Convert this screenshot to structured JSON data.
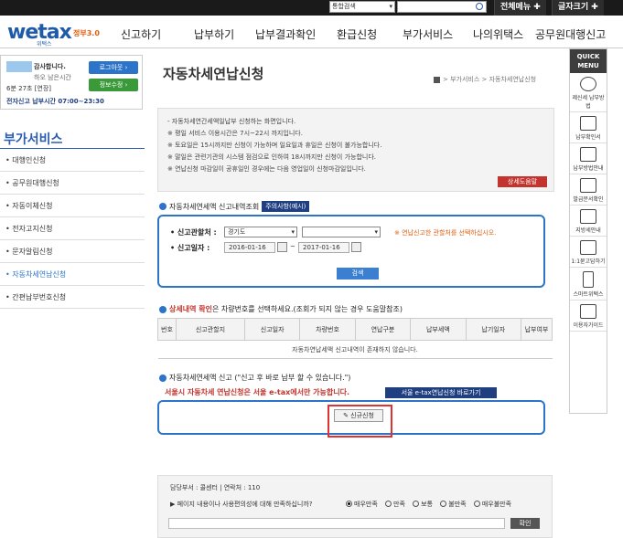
{
  "topbar": {
    "search_scope": "통합검색",
    "all_menu": "전체메뉴",
    "font_size": "글자크기"
  },
  "header": {
    "logo": "wetax",
    "logo_sub": "위택스",
    "logo_tag": "정부3.0",
    "nav": [
      "신고하기",
      "납부하기",
      "납부결과확인",
      "환급신청",
      "부가서비스",
      "나의위택스",
      "공무원대행신고"
    ]
  },
  "login": {
    "greeting": "감사합니다.",
    "line2": "하오 남은시간",
    "timer": "6분 27초 [연장]",
    "hours": "전자신고 납부시간 07:00~23:30",
    "logout": "로그아웃",
    "edit_info": "정보수정"
  },
  "sidebar": {
    "title": "부가서비스",
    "items": [
      {
        "label": "대행인신청"
      },
      {
        "label": "공무원대행신청"
      },
      {
        "label": "자동이체신청"
      },
      {
        "label": "전자고지신청"
      },
      {
        "label": "문자알림신청"
      },
      {
        "label": "자동차세연납신청"
      },
      {
        "label": "간편납부번호신청"
      }
    ]
  },
  "page": {
    "title": "자동차세연납신청",
    "breadcrumb": "> 부가서비스 > 자동차세연납신청",
    "notice": [
      "- 자동차세연간세액일납부 신청하는 화면입니다.",
      "※ 평일 서비스 이용시간은 7시~22시 까지입니다.",
      "※ 토요일은 15시까지만 신청이 가능하며 일요일과 휴일은 신청이 불가능합니다.",
      "※ 말일은 관련기관의 시스템 점검으로 인하여 18시까지만 신청이 가능합니다.",
      "※ 연납신청 마감일이 공휴일인 경우에는 다음 영업일이 신청마감일입니다."
    ],
    "help_button": "상세도움말"
  },
  "search": {
    "section_title": "자동차세연세액 신고내역조회",
    "caution_tag": "주의사항(예시)",
    "region_label": "신고관할처 :",
    "region_value": "경기도",
    "region2_value": "",
    "hint": "※ 연납신고한 관할처를 선택하십시오.",
    "date_label": "신고일자 :",
    "date_from": "2016-01-16",
    "date_sep": "~",
    "date_to": "2017-01-16",
    "search_button": "검색"
  },
  "results": {
    "title_prefix": "상세내역 확인",
    "title_rest": "은 차량번호를 선택하세요.(조회가 되지 않는 경우 도움말참조)",
    "headers": [
      "번호",
      "신고관할지",
      "신고일자",
      "차량번호",
      "연납구분",
      "납부세액",
      "납기일자",
      "납부여부"
    ],
    "empty_message": "자동차연납세액 신고내역이 존재하지 않습니다."
  },
  "apply": {
    "section_title": "자동차세연세액 신고 (\"신고 후 바로 납부 할 수 있습니다.\")",
    "seoul_notice": "서울시 자동차세 연납신청은 서울 e-tax에서만 가능합니다.",
    "seoul_shortcut": "서울 e-tax연납신청 바로가기",
    "apply_button": "신규신청"
  },
  "footer": {
    "dept": "담당부서 : 콜센터 | 연락처 : 110",
    "question": "▶ 페이지 내용이나 사용편의성에 대해 만족하십니까?",
    "options": [
      "매우만족",
      "만족",
      "보통",
      "불만족",
      "매우불만족"
    ],
    "ok_button": "확인"
  },
  "quick_menu": {
    "title": "QUICK MENU",
    "items": [
      "제신세 납부방법",
      "납부확인서",
      "납부방법안내",
      "발급문서확인",
      "지방세안내",
      "1:1묻고답하기",
      "스마트위택스",
      "이용자가이드"
    ]
  }
}
